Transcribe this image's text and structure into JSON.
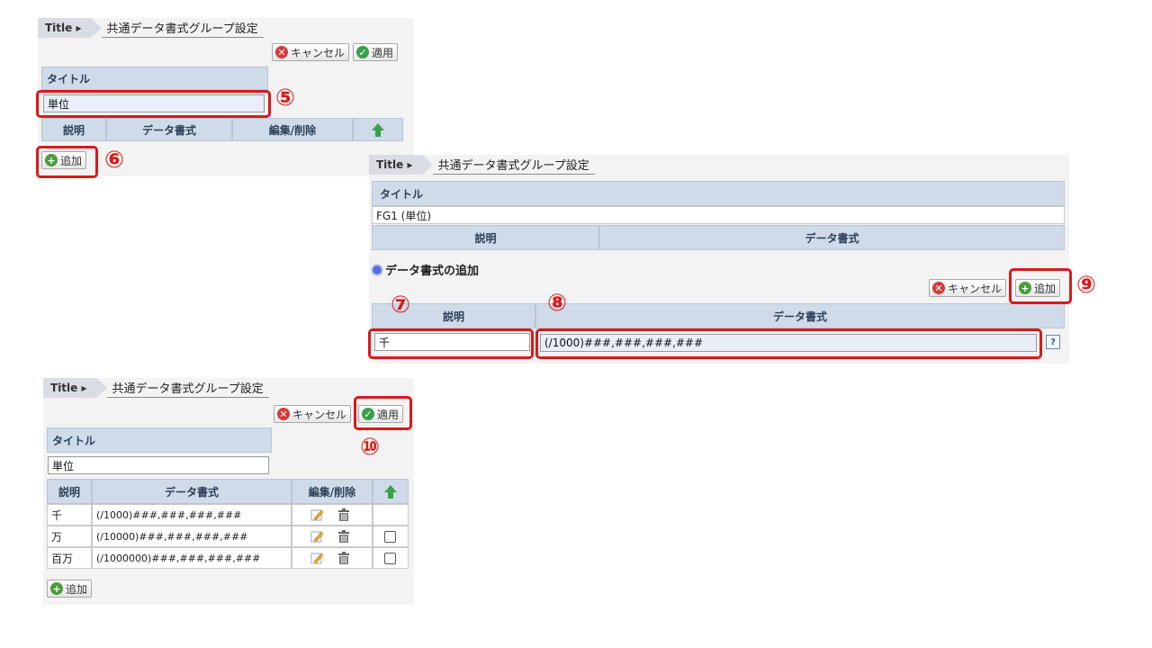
{
  "panel1": {
    "tab_title": "Title ▸",
    "tab_name": "共通データ書式グループ設定",
    "cancel_label": "キャンセル",
    "apply_label": "適用",
    "title_header": "タイトル",
    "title_value": "単位",
    "columns": [
      "説明",
      "データ書式",
      "編集/削除"
    ],
    "add_label": "追加",
    "callouts": [
      "⑤",
      "⑥"
    ]
  },
  "panel2": {
    "tab_title": "Title ▸",
    "tab_name": "共通データ書式グループ設定",
    "title_header": "タイトル",
    "title_value": "FG1 (単位)",
    "columns": [
      "説明",
      "データ書式"
    ],
    "section_label": "データ書式の追加",
    "cancel_label": "キャンセル",
    "add_label": "追加",
    "form_columns": [
      "説明",
      "データ書式"
    ],
    "desc_value": "千",
    "format_value": "(/1000)###,###,###,###",
    "callouts": [
      "⑦",
      "⑧",
      "⑨"
    ]
  },
  "panel3": {
    "tab_title": "Title ▸",
    "tab_name": "共通データ書式グループ設定",
    "cancel_label": "キャンセル",
    "apply_label": "適用",
    "title_header": "タイトル",
    "title_value": "単位",
    "columns": [
      "説明",
      "データ書式",
      "編集/削除"
    ],
    "rows": [
      {
        "desc": "千",
        "format": "(/1000)###,###,###,###"
      },
      {
        "desc": "万",
        "format": "(/10000)###,###,###,###"
      },
      {
        "desc": "百万",
        "format": "(/1000000)###,###,###,###"
      }
    ],
    "add_label": "追加",
    "callouts": [
      "⑩"
    ]
  },
  "colors": {
    "highlight": "#d91a1a",
    "header_bg": "#cfdbe9",
    "accent_green": "#3aa04a"
  }
}
